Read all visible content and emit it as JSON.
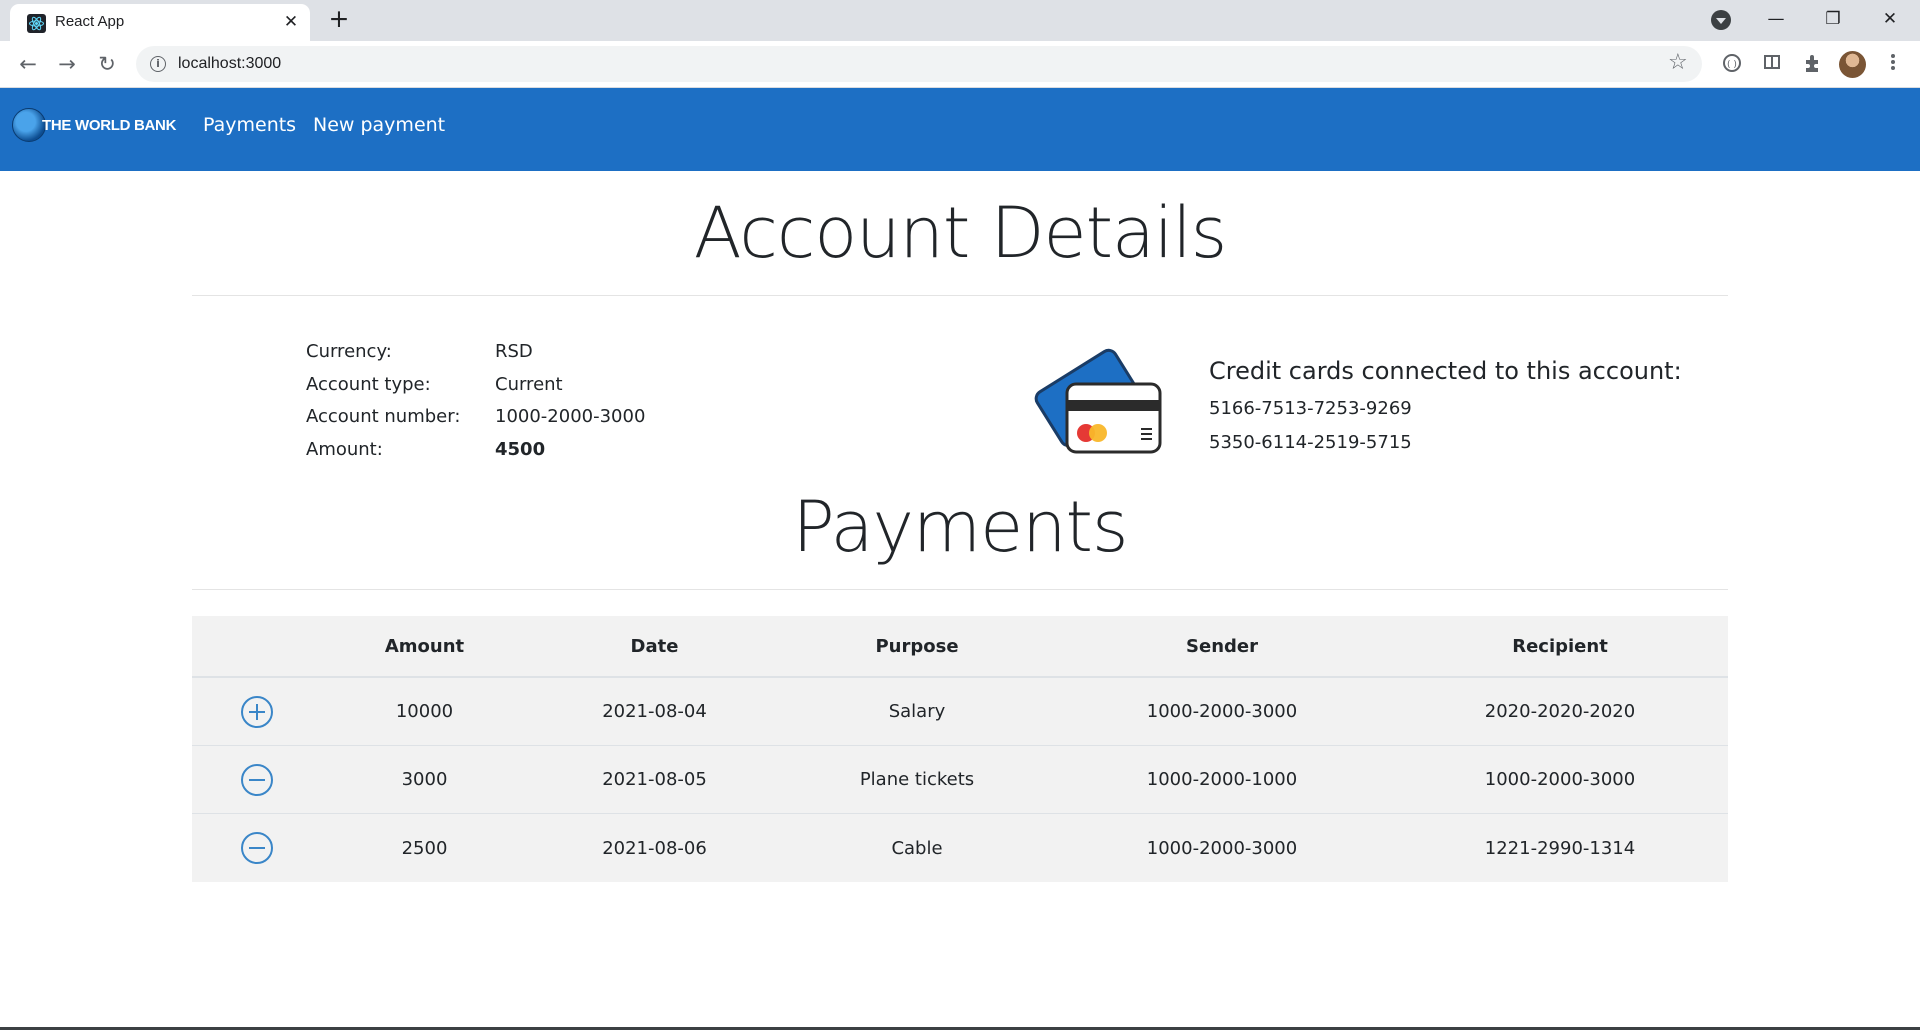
{
  "browser": {
    "tab_title": "React App",
    "tab_close": "✕",
    "new_tab": "+",
    "url": "localhost:3000",
    "back_icon": "←",
    "forward_icon": "→",
    "reload_icon": "↻",
    "info_icon": "i",
    "star_icon": "☆",
    "minimize_icon": "—",
    "maximize_icon": "❐",
    "close_icon": "✕"
  },
  "navbar": {
    "brand": "THE WORLD BANK",
    "links": [
      "Payments",
      "New payment"
    ],
    "color": "#1d6fc4"
  },
  "account": {
    "title": "Account Details",
    "fields": [
      {
        "label": "Currency:",
        "value": "RSD"
      },
      {
        "label": "Account type:",
        "value": "Current"
      },
      {
        "label": "Account number:",
        "value": "1000-2000-3000"
      },
      {
        "label": "Amount:",
        "value": "4500"
      }
    ],
    "cards_heading": "Credit cards connected to this account:",
    "cards": [
      "5166-7513-7253-9269",
      "5350-6114-2519-5715"
    ]
  },
  "payments": {
    "title": "Payments",
    "columns": [
      "",
      "Amount",
      "Date",
      "Purpose",
      "Sender",
      "Recipient"
    ],
    "rows": [
      {
        "direction": "incoming",
        "icon": "plus-circle-icon",
        "amount": "10000",
        "date": "2021-08-04",
        "purpose": "Salary",
        "sender": "1000-2000-3000",
        "recipient": "2020-2020-2020"
      },
      {
        "direction": "outgoing",
        "icon": "minus-circle-icon",
        "amount": "3000",
        "date": "2021-08-05",
        "purpose": "Plane tickets",
        "sender": "1000-2000-1000",
        "recipient": "1000-2000-3000"
      },
      {
        "direction": "outgoing",
        "icon": "minus-circle-icon",
        "amount": "2500",
        "date": "2021-08-06",
        "purpose": "Cable",
        "sender": "1000-2000-3000",
        "recipient": "1221-2990-1314"
      }
    ],
    "icon_color": "#3a86c8"
  }
}
